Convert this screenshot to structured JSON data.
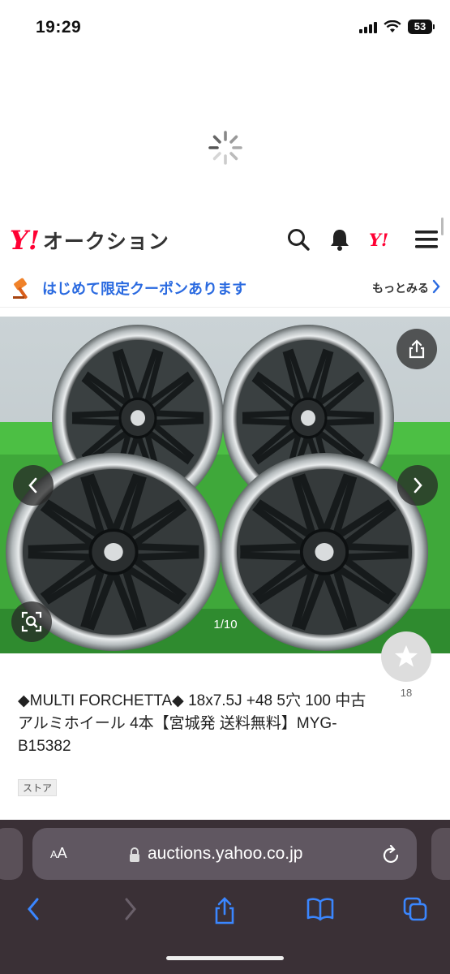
{
  "status_bar": {
    "time": "19:29",
    "battery": "53"
  },
  "header": {
    "logo_mark": "Y!",
    "logo_text": "オークション",
    "icons": [
      "search-icon",
      "bell-icon",
      "yahoo-y-icon",
      "menu-icon"
    ]
  },
  "coupon": {
    "text": "はじめて限定クーポンあります",
    "more": "もっとみる",
    "icon": "hammer-icon"
  },
  "gallery": {
    "counter": "1/10",
    "current": 1,
    "total": 10
  },
  "favorite": {
    "count": "18"
  },
  "item": {
    "title": "◆MULTI FORCHETTA◆ 18x7.5J +48 5穴 100 中古 アルミホイール 4本【宮城発 送料無料】MYG-B15382",
    "badge": "ストア"
  },
  "browser": {
    "aa_small": "A",
    "aa_large": "A",
    "url": "auctions.yahoo.co.jp"
  },
  "colors": {
    "yahoo_red": "#ff0033",
    "link_blue": "#2a6ae0",
    "safari_bg": "#3a3036",
    "pill_bg": "#605761",
    "safari_blue": "#3a86ff"
  }
}
